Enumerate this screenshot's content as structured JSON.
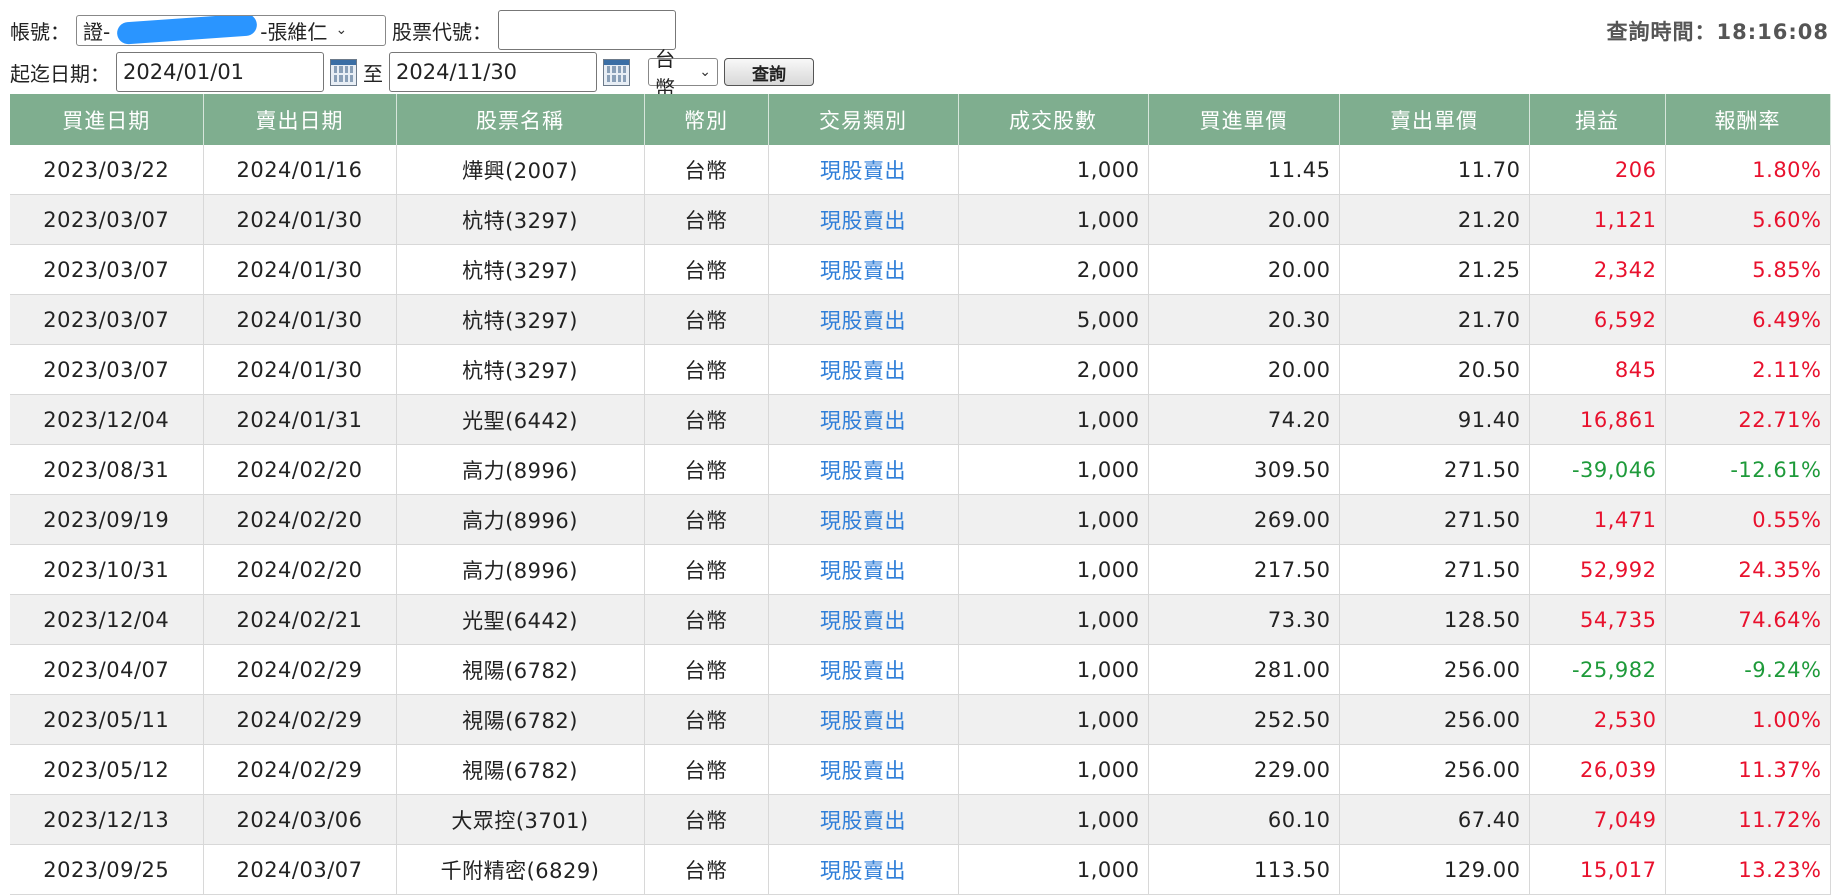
{
  "filters": {
    "account_label": "帳號：",
    "account_value": "證-",
    "account_suffix": "-張維仁",
    "stock_code_label": "股票代號：",
    "stock_code_value": "",
    "date_range_label": "起迄日期：",
    "start_date": "2024/01/01",
    "to_label": "至",
    "end_date": "2024/11/30",
    "currency_value": "台幣",
    "query_button": "查詢",
    "query_time_label": "查詢時間：",
    "query_time_value": "18:16:08"
  },
  "table": {
    "headers": [
      "買進日期",
      "賣出日期",
      "股票名稱",
      "幣別",
      "交易類別",
      "成交股數",
      "買進單價",
      "賣出單價",
      "損益",
      "報酬率"
    ],
    "rows": [
      {
        "buy_date": "2023/03/22",
        "sell_date": "2024/01/16",
        "stock": "燁興(2007)",
        "currency": "台幣",
        "type": "現股賣出",
        "shares": "1,000",
        "buy_price": "11.45",
        "sell_price": "11.70",
        "pnl": "206",
        "return": "1.80%",
        "sign": "pos"
      },
      {
        "buy_date": "2023/03/07",
        "sell_date": "2024/01/30",
        "stock": "杭特(3297)",
        "currency": "台幣",
        "type": "現股賣出",
        "shares": "1,000",
        "buy_price": "20.00",
        "sell_price": "21.20",
        "pnl": "1,121",
        "return": "5.60%",
        "sign": "pos"
      },
      {
        "buy_date": "2023/03/07",
        "sell_date": "2024/01/30",
        "stock": "杭特(3297)",
        "currency": "台幣",
        "type": "現股賣出",
        "shares": "2,000",
        "buy_price": "20.00",
        "sell_price": "21.25",
        "pnl": "2,342",
        "return": "5.85%",
        "sign": "pos"
      },
      {
        "buy_date": "2023/03/07",
        "sell_date": "2024/01/30",
        "stock": "杭特(3297)",
        "currency": "台幣",
        "type": "現股賣出",
        "shares": "5,000",
        "buy_price": "20.30",
        "sell_price": "21.70",
        "pnl": "6,592",
        "return": "6.49%",
        "sign": "pos"
      },
      {
        "buy_date": "2023/03/07",
        "sell_date": "2024/01/30",
        "stock": "杭特(3297)",
        "currency": "台幣",
        "type": "現股賣出",
        "shares": "2,000",
        "buy_price": "20.00",
        "sell_price": "20.50",
        "pnl": "845",
        "return": "2.11%",
        "sign": "pos"
      },
      {
        "buy_date": "2023/12/04",
        "sell_date": "2024/01/31",
        "stock": "光聖(6442)",
        "currency": "台幣",
        "type": "現股賣出",
        "shares": "1,000",
        "buy_price": "74.20",
        "sell_price": "91.40",
        "pnl": "16,861",
        "return": "22.71%",
        "sign": "pos"
      },
      {
        "buy_date": "2023/08/31",
        "sell_date": "2024/02/20",
        "stock": "高力(8996)",
        "currency": "台幣",
        "type": "現股賣出",
        "shares": "1,000",
        "buy_price": "309.50",
        "sell_price": "271.50",
        "pnl": "-39,046",
        "return": "-12.61%",
        "sign": "neg"
      },
      {
        "buy_date": "2023/09/19",
        "sell_date": "2024/02/20",
        "stock": "高力(8996)",
        "currency": "台幣",
        "type": "現股賣出",
        "shares": "1,000",
        "buy_price": "269.00",
        "sell_price": "271.50",
        "pnl": "1,471",
        "return": "0.55%",
        "sign": "pos"
      },
      {
        "buy_date": "2023/10/31",
        "sell_date": "2024/02/20",
        "stock": "高力(8996)",
        "currency": "台幣",
        "type": "現股賣出",
        "shares": "1,000",
        "buy_price": "217.50",
        "sell_price": "271.50",
        "pnl": "52,992",
        "return": "24.35%",
        "sign": "pos"
      },
      {
        "buy_date": "2023/12/04",
        "sell_date": "2024/02/21",
        "stock": "光聖(6442)",
        "currency": "台幣",
        "type": "現股賣出",
        "shares": "1,000",
        "buy_price": "73.30",
        "sell_price": "128.50",
        "pnl": "54,735",
        "return": "74.64%",
        "sign": "pos"
      },
      {
        "buy_date": "2023/04/07",
        "sell_date": "2024/02/29",
        "stock": "視陽(6782)",
        "currency": "台幣",
        "type": "現股賣出",
        "shares": "1,000",
        "buy_price": "281.00",
        "sell_price": "256.00",
        "pnl": "-25,982",
        "return": "-9.24%",
        "sign": "neg"
      },
      {
        "buy_date": "2023/05/11",
        "sell_date": "2024/02/29",
        "stock": "視陽(6782)",
        "currency": "台幣",
        "type": "現股賣出",
        "shares": "1,000",
        "buy_price": "252.50",
        "sell_price": "256.00",
        "pnl": "2,530",
        "return": "1.00%",
        "sign": "pos"
      },
      {
        "buy_date": "2023/05/12",
        "sell_date": "2024/02/29",
        "stock": "視陽(6782)",
        "currency": "台幣",
        "type": "現股賣出",
        "shares": "1,000",
        "buy_price": "229.00",
        "sell_price": "256.00",
        "pnl": "26,039",
        "return": "11.37%",
        "sign": "pos"
      },
      {
        "buy_date": "2023/12/13",
        "sell_date": "2024/03/06",
        "stock": "大眾控(3701)",
        "currency": "台幣",
        "type": "現股賣出",
        "shares": "1,000",
        "buy_price": "60.10",
        "sell_price": "67.40",
        "pnl": "7,049",
        "return": "11.72%",
        "sign": "pos"
      },
      {
        "buy_date": "2023/09/25",
        "sell_date": "2024/03/07",
        "stock": "千附精密(6829)",
        "currency": "台幣",
        "type": "現股賣出",
        "shares": "1,000",
        "buy_price": "113.50",
        "sell_price": "129.00",
        "pnl": "15,017",
        "return": "13.23%",
        "sign": "pos"
      }
    ]
  },
  "colors": {
    "header_bg": "#7fae8f",
    "profit": "#e8112d",
    "loss": "#1e9a3a",
    "link": "#2f7ed8"
  }
}
